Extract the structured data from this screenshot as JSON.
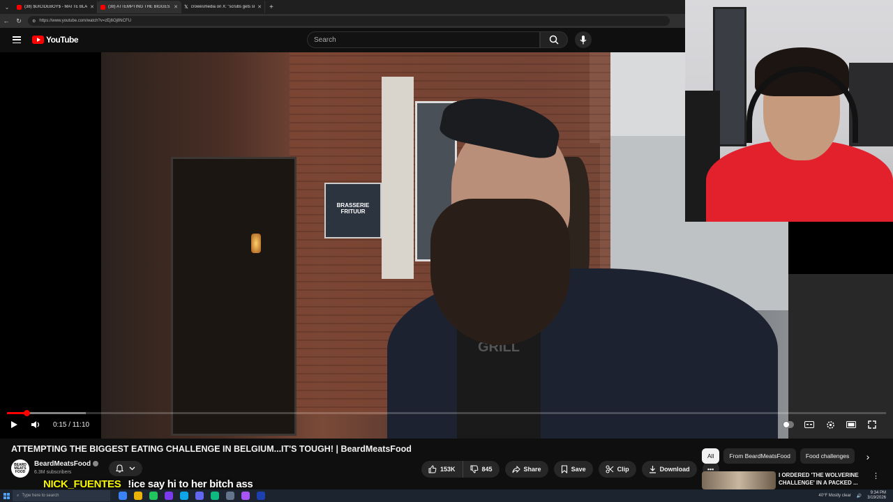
{
  "browser": {
    "tabs": [
      {
        "title": "(38) $UICIDEBOY$ - MATTE BLACK",
        "active": false,
        "icon": "youtube-icon"
      },
      {
        "title": "(38) ATTEMPTING THE BIGGEST EATING",
        "active": true,
        "icon": "youtube-icon"
      },
      {
        "title": "crowesmedia on X: \"scrubs gets sl",
        "active": false,
        "icon": "x-icon"
      }
    ],
    "url": "https://www.youtube.com/watch?v=zEj6Oj8NCFU"
  },
  "youtube": {
    "logo_text": "YouTube",
    "search_placeholder": "Search"
  },
  "video": {
    "sign_text": "BRASSERIE FRITUUR",
    "shirt_text": "T ATTA GRILL",
    "current_time": "0:15",
    "duration": "11:10",
    "time_display": "0:15 / 11:10",
    "progress_fraction": 0.0224,
    "buffered_fraction": 0.09
  },
  "meta": {
    "title": "ATTEMPTING THE BIGGEST EATING CHALLENGE IN BELGIUM...IT'S TOUGH! | BeardMeatsFood",
    "channel_name": "BeardMeatsFood",
    "avatar_text": "BEARD MEATS FOOD",
    "subscribers": "6.3M subscribers",
    "likes": "153K",
    "dislikes": "845",
    "share": "Share",
    "save": "Save",
    "clip": "Clip",
    "download": "Download"
  },
  "chat_overlay": {
    "username": "NICK_FUENTES",
    "message": "!ice say hi to her bitch ass"
  },
  "sidebar": {
    "chips": [
      "All",
      "From BeardMeatsFood",
      "Food challenges"
    ],
    "recommendation_title": "I ORDERED 'THE WOLVERINE CHALLENGE' IN A PACKED ..."
  },
  "taskbar": {
    "search_placeholder": "Type here to search",
    "weather": "40°F  Mostly clear",
    "time": "9:34 PM",
    "date": "3/19/2026"
  },
  "colors": {
    "accent": "#ff0000",
    "background": "#0f0f0f",
    "chat_name": "#f6f600"
  }
}
